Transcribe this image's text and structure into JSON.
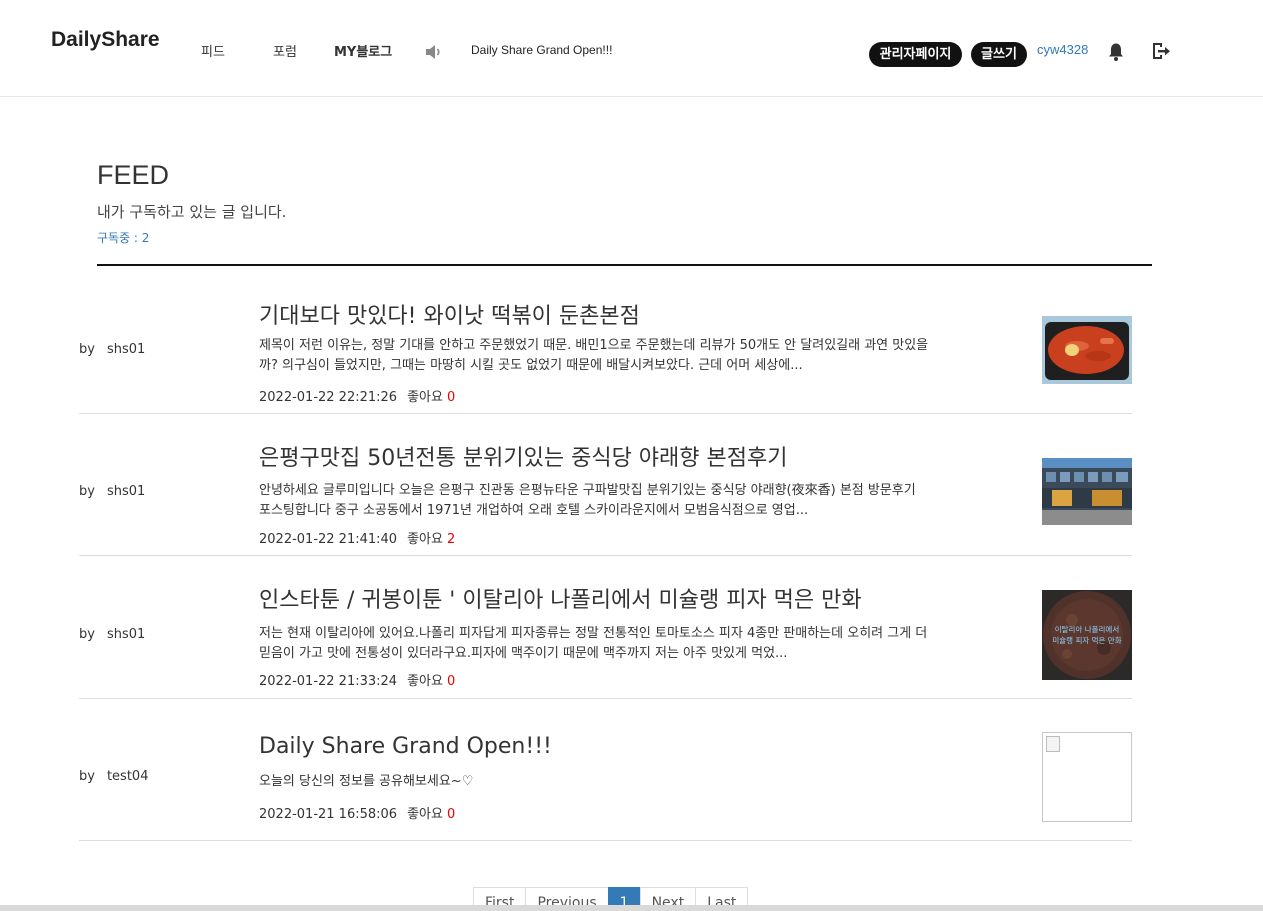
{
  "header": {
    "logo": "DailyShare",
    "nav": {
      "feed": "피드",
      "forum": "포럼",
      "my_blog": "MY블로그"
    },
    "notice": "Daily Share Grand Open!!!",
    "admin_button": "관리자페이지",
    "write_button": "글쓰기",
    "username": "cyw4328",
    "icons": [
      "speaker-icon",
      "bell-icon",
      "logout-icon"
    ]
  },
  "feed": {
    "title": "FEED",
    "subtitle": "내가 구독하고 있는 글 입니다.",
    "subscribing": "구독중 : 2"
  },
  "posts": [
    {
      "by": "by",
      "author": "shs01",
      "title": "기대보다 맛있다! 와이낫 떡볶이 둔촌본점",
      "body": "제목이 저런 이유는, 정말 기대를 안하고 주문했었기 때문. 배민1으로 주문했는데 리뷰가 50개도 안 달려있길래 과연 맛있을까? 의구심이 들었지만, 그때는 마땅히 시킬 곳도 없었기 때문에 배달시켜보았다. 근데 어머 세상에...",
      "date": "2022-01-22 22:21:26",
      "likes_label": "좋아요",
      "likes": "0"
    },
    {
      "by": "by",
      "author": "shs01",
      "title": "은평구맛집 50년전통 분위기있는 중식당 야래향 본점후기",
      "body": "안녕하세요 글루미입니다 오늘은 은평구 진관동 은평뉴타운 구파발맛집 분위기있는 중식당 야래향(夜來香) 본점 방문후기 포스팅합니다 중구 소공동에서 1971년 개업하여 오래 호텔 스카이라운지에서 모범음식점으로 영업...",
      "date": "2022-01-22 21:41:40",
      "likes_label": "좋아요",
      "likes": "2"
    },
    {
      "by": "by",
      "author": "shs01",
      "title": "인스타툰 / 귀봉이툰 ' 이탈리아 나폴리에서 미슐랭 피자 먹은 만화",
      "body": "저는 현재 이탈리아에 있어요.나폴리 피자답게 피자종류는 정말 전통적인 토마토소스 피자 4종만 판매하는데 오히려 그게 더 믿음이 가고 맛에 전통성이 있더라구요.피자에 맥주이기 때문에 맥주까지 저는 아주 맛있게 먹었...",
      "date": "2022-01-22 21:33:24",
      "likes_label": "좋아요",
      "likes": "0",
      "thumb_text": [
        "이탈리아 나폴리에서",
        "미슐랭 피자 먹은 만화"
      ]
    },
    {
      "by": "by",
      "author": "test04",
      "title": "Daily Share Grand Open!!!",
      "body": "오늘의 당신의 정보를 공유해보세요~♡",
      "date": "2022-01-21 16:58:06",
      "likes_label": "좋아요",
      "likes": "0"
    }
  ],
  "pagination": {
    "first": "First",
    "previous": "Previous",
    "current": "1",
    "next": "Next",
    "last": "Last"
  },
  "colors": {
    "accent": "#337ab7",
    "likes": "#e00000",
    "pill": "#111111"
  }
}
